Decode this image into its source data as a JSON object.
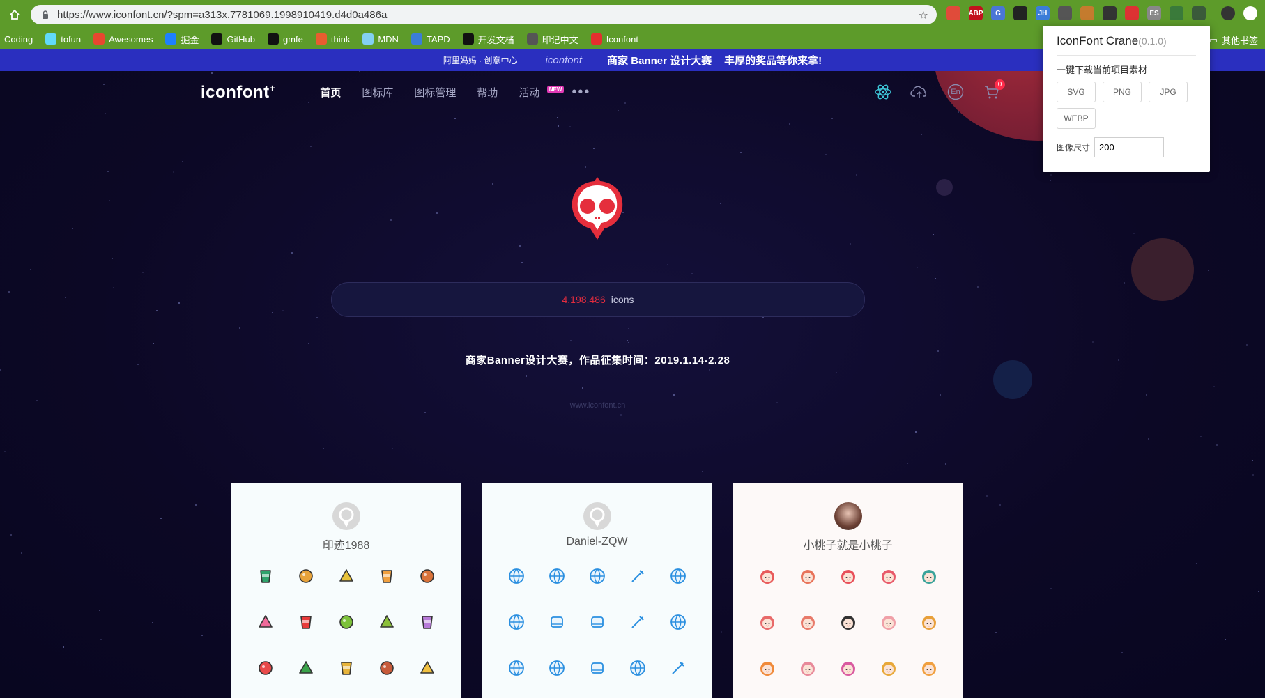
{
  "browser": {
    "url": "https://www.iconfont.cn/?spm=a313x.7781069.1998910419.d4d0a486a",
    "extensions": [
      {
        "name": "chrome-ext-icon",
        "label": "",
        "color": "#e04b3a"
      },
      {
        "name": "abp-icon",
        "label": "ABP",
        "color": "#c3111d"
      },
      {
        "name": "translate-icon",
        "label": "G",
        "color": "#4a76d6"
      },
      {
        "name": "mask-icon",
        "label": "",
        "color": "#222"
      },
      {
        "name": "jh-icon",
        "label": "JH",
        "color": "#3b7dd8"
      },
      {
        "name": "search-ext-icon",
        "label": "",
        "color": "#555"
      },
      {
        "name": "cookie-icon",
        "label": "",
        "color": "#c47b2e"
      },
      {
        "name": "panel-icon",
        "label": "",
        "color": "#333"
      },
      {
        "name": "pinwheel-icon",
        "label": "",
        "color": "#d33"
      },
      {
        "name": "es-icon",
        "label": "ES",
        "color": "#888"
      },
      {
        "name": "leaf-icon",
        "label": "",
        "color": "#3a7a3a"
      },
      {
        "name": "iconfont-crane-icon",
        "label": "",
        "color": "#3a5a3a"
      }
    ],
    "bookmarks": [
      {
        "name": "bookmark-coding",
        "label": "Coding",
        "icon": "",
        "color": ""
      },
      {
        "name": "bookmark-tofun",
        "label": "tofun",
        "icon": "react-icon",
        "color": "#61dafb"
      },
      {
        "name": "bookmark-awesomes",
        "label": "Awesomes",
        "icon": "a-icon",
        "color": "#e8472f"
      },
      {
        "name": "bookmark-juejin",
        "label": "掘金",
        "icon": "juejin-icon",
        "color": "#1e80ff"
      },
      {
        "name": "bookmark-github",
        "label": "GitHub",
        "icon": "github-icon",
        "color": "#111"
      },
      {
        "name": "bookmark-gmfe",
        "label": "gmfe",
        "icon": "github-icon",
        "color": "#111"
      },
      {
        "name": "bookmark-think",
        "label": "think",
        "icon": "think-icon",
        "color": "#e85d2f"
      },
      {
        "name": "bookmark-mdn",
        "label": "MDN",
        "icon": "mdn-icon",
        "color": "#83d0f2"
      },
      {
        "name": "bookmark-tapd",
        "label": "TAPD",
        "icon": "tapd-icon",
        "color": "#3b7dd8"
      },
      {
        "name": "bookmark-devdocs",
        "label": "开发文档",
        "icon": "cap-icon",
        "color": "#111"
      },
      {
        "name": "bookmark-yinji",
        "label": "印记中文",
        "icon": "yinji-icon",
        "color": "#555"
      },
      {
        "name": "bookmark-iconfont",
        "label": "Iconfont",
        "icon": "iconfont-icon",
        "color": "#e52e2e"
      }
    ],
    "other_bookmarks": "其他书签"
  },
  "promo": {
    "ali": "阿里妈妈 · 创意中心",
    "brand": "iconfont",
    "text1": "商家 Banner 设计大赛",
    "text2": "丰厚的奖品等你来拿!"
  },
  "nav": {
    "logo": "iconfont",
    "items": [
      {
        "label": "首页",
        "active": true
      },
      {
        "label": "图标库"
      },
      {
        "label": "图标管理"
      },
      {
        "label": "帮助"
      },
      {
        "label": "活动",
        "badge": "NEW"
      }
    ],
    "cart_count": "0",
    "lang": "En"
  },
  "hero": {
    "icon_count": "4,198,486",
    "icon_unit": "icons",
    "campaign": "商家Banner设计大赛，作品征集时间：2019.1.14-2.28",
    "domain": "www.iconfont.cn"
  },
  "cards": [
    {
      "name": "印迹1988",
      "theme": "colorful-food",
      "icons": [
        "cup-icon",
        "burger-icon",
        "cocktail-icon",
        "pizza-icon",
        "drumstick-icon",
        "icecream-icon",
        "fries-icon",
        "grapes-icon",
        "corn-icon",
        "onion-icon",
        "popsicle-icon",
        "watermelon-icon",
        "balls-icon",
        "cake-icon",
        "banana-icon"
      ]
    },
    {
      "name": "Daniel-ZQW",
      "theme": "blue-sports",
      "icons": [
        "basketball-icon",
        "volleyball-icon",
        "ring-icon",
        "badminton-icon",
        "baseball-icon",
        "football-icon",
        "skate-icon",
        "sock-icon",
        "shoe-icon",
        "hockey-icon",
        "pingpong-icon",
        "goggles-icon",
        "dumbbell-icon",
        "soccer-icon",
        "golf-icon"
      ]
    },
    {
      "name": "小桃子就是小桃子",
      "theme": "avatar-faces",
      "icons": [
        "face-1-icon",
        "face-2-icon",
        "face-3-icon",
        "face-4-icon",
        "face-5-icon",
        "face-6-icon",
        "face-7-icon",
        "face-8-icon",
        "face-9-icon",
        "face-10-icon",
        "face-11-icon",
        "face-12-icon",
        "face-13-icon",
        "face-14-icon",
        "face-15-icon"
      ]
    }
  ],
  "popup": {
    "title": "IconFont Crane",
    "version": "(0.1.0)",
    "subtitle": "一键下载当前项目素材",
    "buttons": [
      "SVG",
      "PNG",
      "JPG",
      "WEBP"
    ],
    "size_label": "图像尺寸",
    "size_value": "200"
  },
  "colors": {
    "chrome": "#5d9b2a",
    "promo": "#2a2fbf",
    "page_bg": "#0e0a28",
    "accent_red": "#e32c3e",
    "sport_blue": "#2a8fe0"
  }
}
